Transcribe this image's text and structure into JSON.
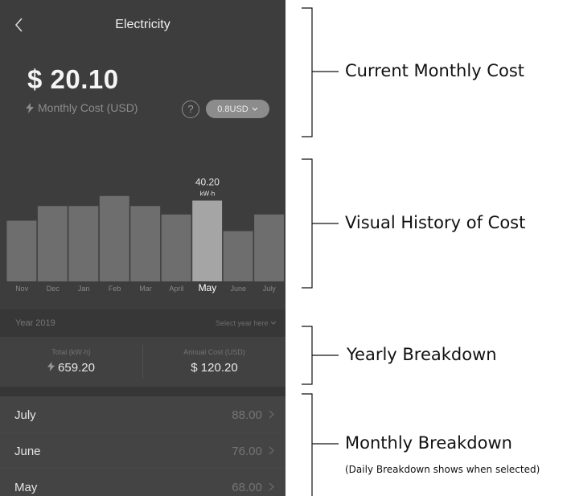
{
  "header": {
    "title": "Electricity"
  },
  "cost": {
    "value": "$ 20.10",
    "label": "Monthly Cost (USD)",
    "help": "?",
    "rate": "0.8USD"
  },
  "chart": {
    "highlight_value": "40.20",
    "highlight_unit": "kW·h",
    "months": [
      "Nov",
      "Dec",
      "Jan",
      "Feb",
      "Mar",
      "April",
      "May",
      "June",
      "July"
    ]
  },
  "chart_data": {
    "type": "bar",
    "categories": [
      "Nov",
      "Dec",
      "Jan",
      "Feb",
      "Mar",
      "April",
      "May",
      "June",
      "July"
    ],
    "values": [
      30.2,
      37.5,
      37.5,
      42.5,
      37.5,
      33.3,
      40.2,
      25.0,
      33.3
    ],
    "selected": "May",
    "bar_color": "#6e6e6e",
    "selected_color": "#a5a5a5"
  },
  "year": {
    "label": "Year 2019",
    "select": "Select year here"
  },
  "summary": {
    "total_label": "Total (kW·h)",
    "total_value": "659.20",
    "annual_label": "Annual Cost (USD)",
    "annual_value": "$ 120.20"
  },
  "list": [
    {
      "month": "July",
      "value": "88.00"
    },
    {
      "month": "June",
      "value": "76.00"
    },
    {
      "month": "May",
      "value": "68.00"
    }
  ],
  "annotations": {
    "current": "Current Monthly Cost",
    "history": "Visual History of Cost",
    "yearly": "Yearly Breakdown",
    "monthly": "Monthly Breakdown",
    "monthly_note": "(Daily Breakdown shows when selected)"
  }
}
